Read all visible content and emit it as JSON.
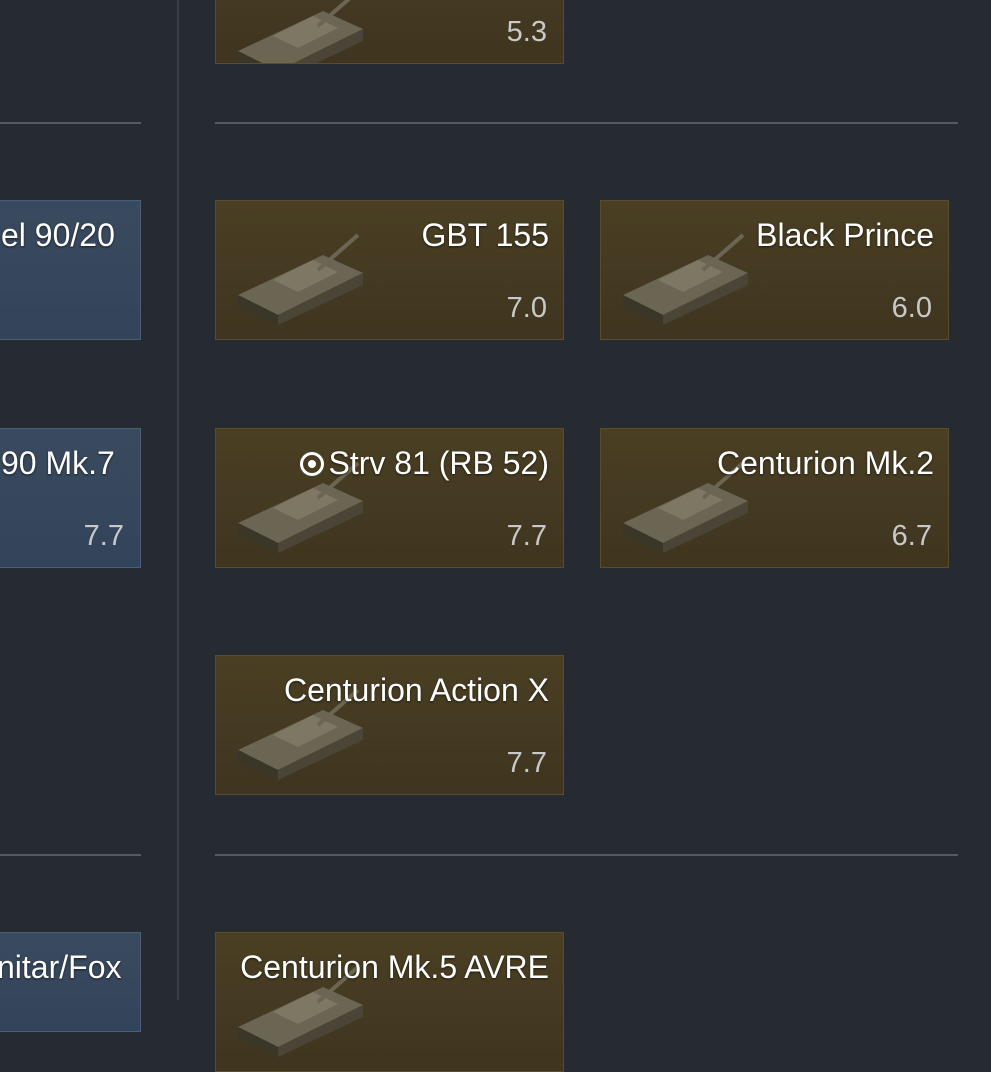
{
  "left_column": {
    "cards": [
      {
        "name": "el 90/20",
        "br": ""
      },
      {
        "name": "90 Mk.7",
        "br": "7.7"
      },
      {
        "name": "nitar/Fox",
        "br": ""
      }
    ]
  },
  "right_column": {
    "top_card": {
      "br": "5.3"
    },
    "cards": [
      {
        "name": "GBT 155",
        "br": "7.0",
        "icon": "tank-icon"
      },
      {
        "name": "Black Prince",
        "br": "6.0",
        "icon": "tank-icon"
      },
      {
        "name": "Strv 81 (RB 52)",
        "br": "7.7",
        "icon": "tank-icon",
        "marker": "target-icon"
      },
      {
        "name": "Centurion Mk.2",
        "br": "6.7",
        "icon": "tank-icon"
      },
      {
        "name": "Centurion Action X",
        "br": "7.7",
        "icon": "tank-icon"
      },
      {
        "name": "Centurion Mk.5 AVRE",
        "br": "",
        "icon": "tank-icon"
      }
    ]
  },
  "colors": {
    "background": "#262b31",
    "card_gold": "#463b22",
    "card_blue": "#36465b"
  }
}
